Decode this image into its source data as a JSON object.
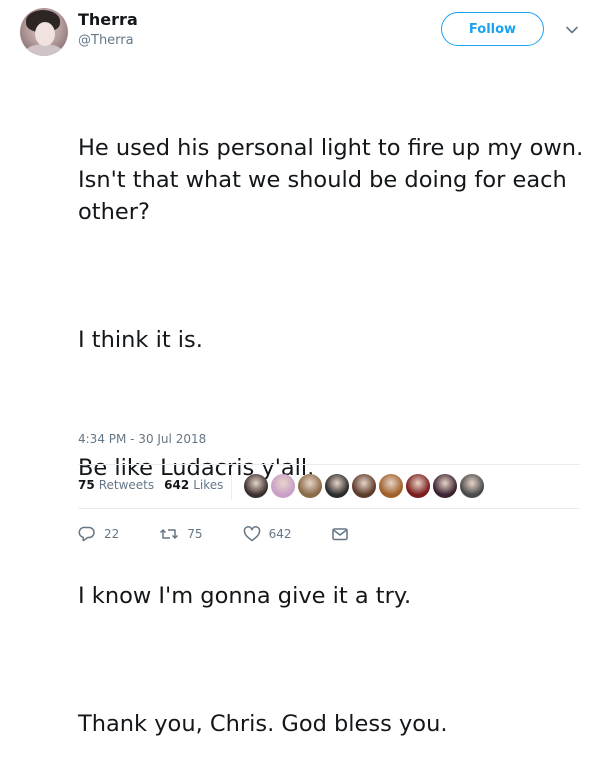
{
  "author": {
    "name": "Therra",
    "handle": "@Therra"
  },
  "follow_label": "Follow",
  "tweet": {
    "paragraphs": [
      "He used his personal light to fire up my own. Isn't that what we should be doing for each other?",
      "I think it is.",
      "Be like Ludacris y'all.",
      "I know I'm gonna give it a try.",
      "Thank you, Chris. God bless you."
    ],
    "timestamp": "4:34 PM - 30 Jul 2018"
  },
  "stats": {
    "retweets_count": "75",
    "retweets_label": "Retweets",
    "likes_count": "642",
    "likes_label": "Likes"
  },
  "likers": [
    {
      "color": "#3b2f2f"
    },
    {
      "color": "#c9a0c8"
    },
    {
      "color": "#8a6a48"
    },
    {
      "color": "#2b2b2b"
    },
    {
      "color": "#5c3a2a"
    },
    {
      "color": "#a0602a"
    },
    {
      "color": "#7a1c1c"
    },
    {
      "color": "#3a2230"
    },
    {
      "color": "#4a4a4a"
    }
  ],
  "actions": {
    "reply_count": "22",
    "retweet_count": "75",
    "like_count": "642"
  },
  "colors": {
    "accent": "#1da1f2",
    "text": "#14171a",
    "muted": "#657786"
  }
}
